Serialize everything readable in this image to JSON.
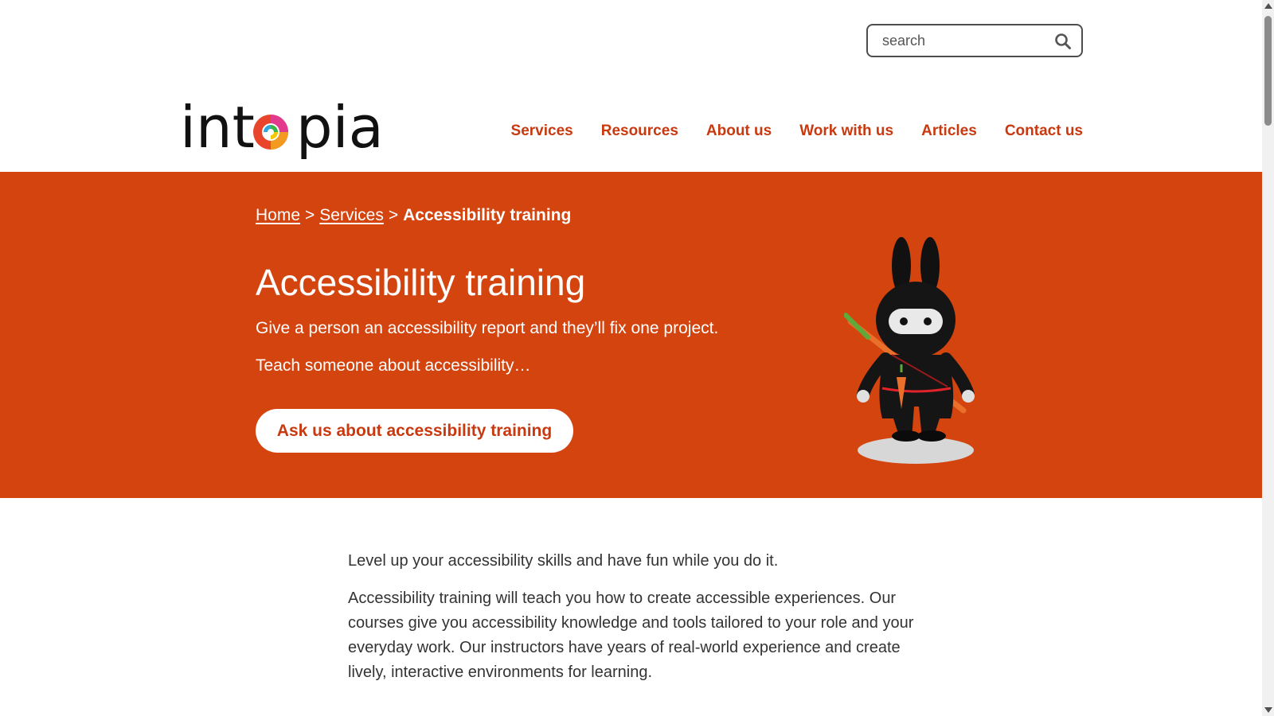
{
  "header": {
    "search_placeholder": "search",
    "logo_text_before": "int",
    "logo_text_after": "pia",
    "nav": [
      {
        "label": "Services"
      },
      {
        "label": "Resources"
      },
      {
        "label": "About us"
      },
      {
        "label": "Work with us"
      },
      {
        "label": "Articles"
      },
      {
        "label": "Contact us"
      }
    ]
  },
  "hero": {
    "breadcrumb": {
      "home": "Home",
      "separator": ">",
      "services": "Services",
      "current": "Accessibility training"
    },
    "title": "Accessibility training",
    "line1": "Give a person an accessibility report and they’ll fix one project.",
    "line2": "Teach someone about accessibility…",
    "cta_label": "Ask us about accessibility training",
    "mascot_icon": "ninja-bunny-mascot"
  },
  "content": {
    "paragraphs": [
      "Level up your accessibility skills and have fun while you do it.",
      "Accessibility training will teach you how to create accessible experiences. Our courses give you accessibility knowledge and tools tailored to your role and your everyday work. Our instructors have years of real-world experience and create lively, interactive environments for learning."
    ]
  },
  "colors": {
    "brand": "#d4440f",
    "link": "#c9390f",
    "text": "#333333"
  }
}
